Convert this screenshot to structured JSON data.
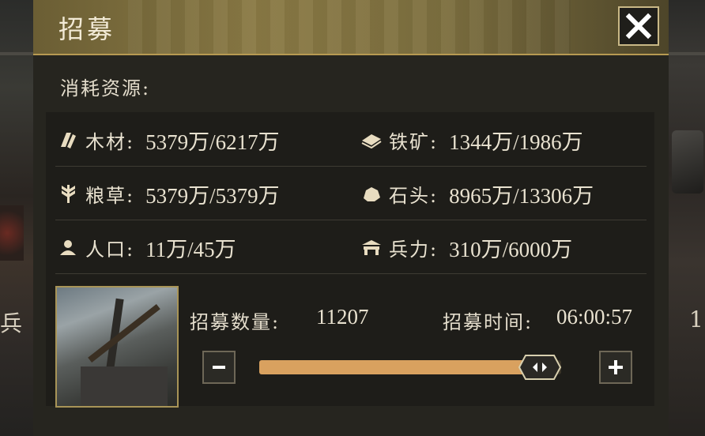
{
  "background": {
    "left_text": "兵",
    "right_text": "1"
  },
  "dialog": {
    "title": "招募",
    "close_icon": "close-icon",
    "consume_label": "消耗资源:",
    "resources": [
      {
        "icon": "wood-icon",
        "label": "木材:",
        "value": "5379万/6217万"
      },
      {
        "icon": "iron-ore-icon",
        "label": "铁矿:",
        "value": "1344万/1986万"
      },
      {
        "icon": "grain-icon",
        "label": "粮草:",
        "value": "5379万/5379万"
      },
      {
        "icon": "stone-icon",
        "label": "石头:",
        "value": "8965万/13306万"
      },
      {
        "icon": "population-icon",
        "label": "人口:",
        "value": "11万/45万"
      },
      {
        "icon": "troops-icon",
        "label": "兵力:",
        "value": "310万/6000万"
      }
    ],
    "recruit": {
      "count_label": "招募数量:",
      "count_value": "11207",
      "time_label": "招募时间:",
      "time_value": "06:00:57",
      "slider_fraction": 0.93
    },
    "colors": {
      "accent": "#d9a15f",
      "header": "#8a7a45",
      "border": "#c9b886"
    }
  }
}
